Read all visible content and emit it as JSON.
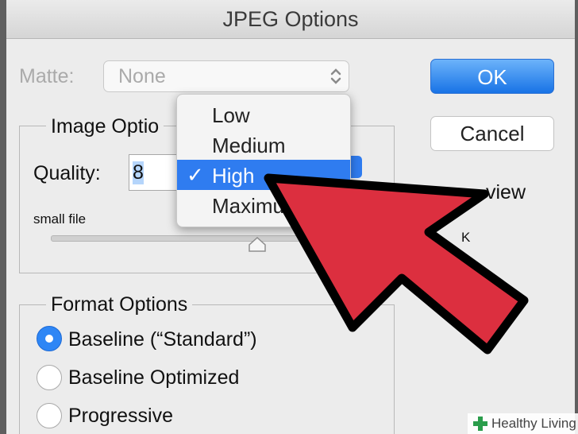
{
  "window": {
    "title": "JPEG Options"
  },
  "matte": {
    "label": "Matte:",
    "value": "None"
  },
  "buttons": {
    "ok": "OK",
    "cancel": "Cancel"
  },
  "image_options": {
    "legend": "Image Optio",
    "quality_label": "Quality:",
    "quality_value": "8",
    "small_file": "small file"
  },
  "quality_menu": {
    "items": [
      "Low",
      "Medium",
      "High",
      "Maximu"
    ],
    "selected_index": 2,
    "check": "✓"
  },
  "right_partial": {
    "preview": "view",
    "size": "K"
  },
  "format_options": {
    "legend": "Format Options",
    "options": [
      "Baseline (“Standard”)",
      "Baseline Optimized",
      "Progressive"
    ],
    "selected_index": 0
  },
  "annotation": {
    "arrow_color": "#dc2f3f"
  },
  "watermark": {
    "text": "Healthy Living",
    "brand_color": "#2a9d4b"
  }
}
